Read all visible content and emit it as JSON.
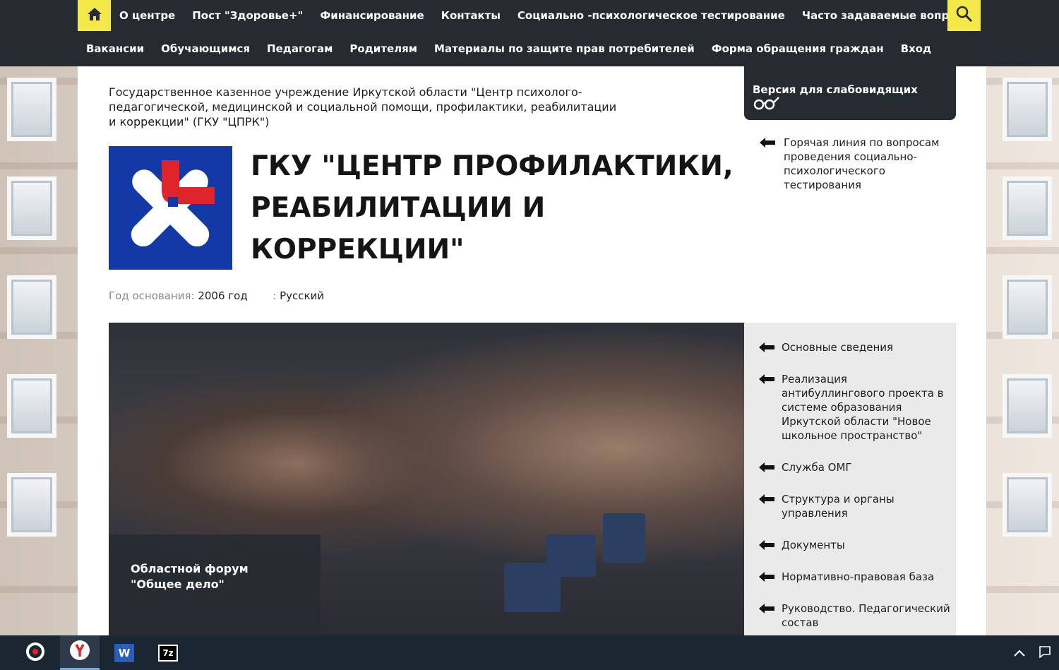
{
  "nav": {
    "row1": [
      "О центре",
      "Пост \"Здоровье+\"",
      "Финансирование",
      "Контакты",
      "Социально -психологическое тестирование",
      "Часто задаваемые вопросы"
    ],
    "row2": [
      "Вакансии",
      "Обучающимся",
      "Педагогам",
      "Родителям",
      "Материалы по защите прав потребителей",
      "Форма обращения граждан",
      "Вход"
    ],
    "home_icon": "home-icon",
    "search_icon": "search-icon"
  },
  "header": {
    "org_full_name": "Государственное казенное учреждение Иркутской области \"Центр психолого-педагогической, медицинской и социальной помощи, профилактики, реабилитации и коррекции\" (ГКУ \"ЦПРК\")",
    "title": "ГКУ \"ЦЕНТР ПРОФИЛАКТИКИ, РЕАБИЛИТАЦИИ И КОРРЕКЦИИ\"",
    "founded_label": "Год основания:",
    "founded_value": "2006 год",
    "lang_sep": ":",
    "lang_value": "Русский"
  },
  "vision": {
    "label": "Версия для слабовидящих",
    "icon": "glasses-icon"
  },
  "hotline": {
    "text": "Горячая линия по вопросам проведения социально-психологического тестирования"
  },
  "slider": {
    "caption": "Областной форум \"Общее дело\""
  },
  "side_menu": [
    "Основные сведения",
    "Реализация антибуллингового проекта в системе образования Иркутской области \"Новое школьное пространство\"",
    "Служба ОМГ",
    "Структура и органы управления",
    "Документы",
    "Нормативно-правовая база",
    "Руководство. Педагогический состав"
  ],
  "colors": {
    "nav_bg": "#262a31",
    "accent_yellow": "#f5e84a",
    "logo_blue": "#1239a5",
    "logo_red": "#e0242b",
    "side_bg": "#eaeaea",
    "taskbar_bg": "#1b2633"
  },
  "taskbar": {
    "apps": [
      "cortana-icon",
      "yandex-browser-icon",
      "word-icon",
      "7zip-icon"
    ],
    "word_letter": "W",
    "zip_label": "7z"
  }
}
